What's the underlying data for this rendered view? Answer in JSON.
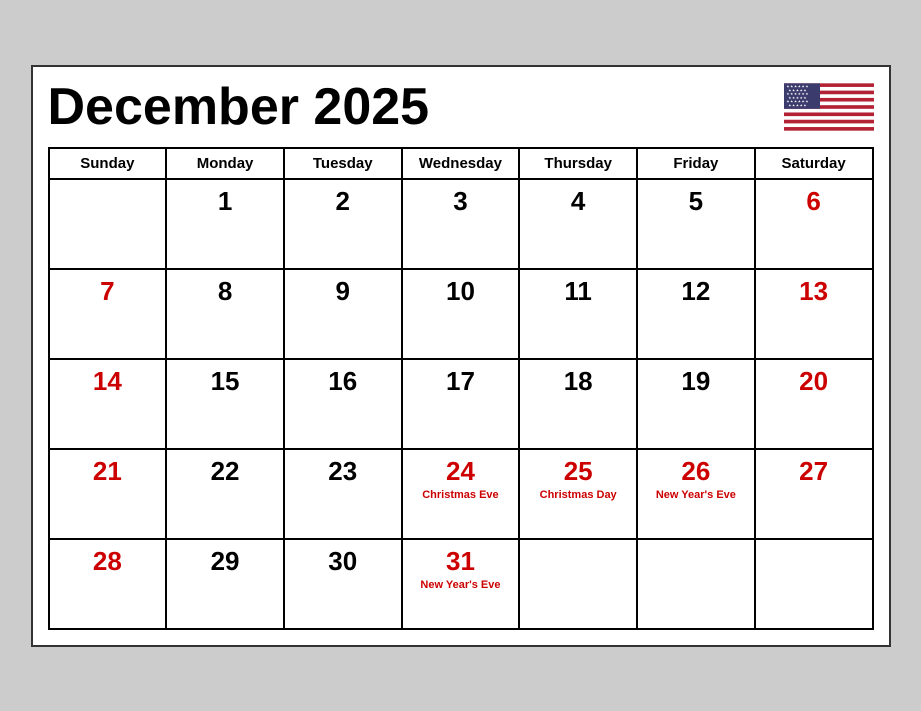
{
  "header": {
    "title": "December 2025"
  },
  "days_of_week": [
    "Sunday",
    "Monday",
    "Tuesday",
    "Wednesday",
    "Thursday",
    "Friday",
    "Saturday"
  ],
  "weeks": [
    [
      {
        "num": "",
        "color": "black",
        "holiday": ""
      },
      {
        "num": "1",
        "color": "black",
        "holiday": ""
      },
      {
        "num": "2",
        "color": "black",
        "holiday": ""
      },
      {
        "num": "3",
        "color": "black",
        "holiday": ""
      },
      {
        "num": "4",
        "color": "black",
        "holiday": ""
      },
      {
        "num": "5",
        "color": "black",
        "holiday": ""
      },
      {
        "num": "6",
        "color": "red",
        "holiday": ""
      }
    ],
    [
      {
        "num": "7",
        "color": "red",
        "holiday": ""
      },
      {
        "num": "8",
        "color": "black",
        "holiday": ""
      },
      {
        "num": "9",
        "color": "black",
        "holiday": ""
      },
      {
        "num": "10",
        "color": "black",
        "holiday": ""
      },
      {
        "num": "11",
        "color": "black",
        "holiday": ""
      },
      {
        "num": "12",
        "color": "black",
        "holiday": ""
      },
      {
        "num": "13",
        "color": "red",
        "holiday": ""
      }
    ],
    [
      {
        "num": "14",
        "color": "red",
        "holiday": ""
      },
      {
        "num": "15",
        "color": "black",
        "holiday": ""
      },
      {
        "num": "16",
        "color": "black",
        "holiday": ""
      },
      {
        "num": "17",
        "color": "black",
        "holiday": ""
      },
      {
        "num": "18",
        "color": "black",
        "holiday": ""
      },
      {
        "num": "19",
        "color": "black",
        "holiday": ""
      },
      {
        "num": "20",
        "color": "red",
        "holiday": ""
      }
    ],
    [
      {
        "num": "21",
        "color": "red",
        "holiday": ""
      },
      {
        "num": "22",
        "color": "black",
        "holiday": ""
      },
      {
        "num": "23",
        "color": "black",
        "holiday": ""
      },
      {
        "num": "24",
        "color": "red",
        "holiday": "Christmas Eve"
      },
      {
        "num": "25",
        "color": "red",
        "holiday": "Christmas Day"
      },
      {
        "num": "26",
        "color": "red",
        "holiday": "New Year's Eve"
      },
      {
        "num": "27",
        "color": "red",
        "holiday": ""
      }
    ],
    [
      {
        "num": "28",
        "color": "red",
        "holiday": ""
      },
      {
        "num": "29",
        "color": "black",
        "holiday": ""
      },
      {
        "num": "30",
        "color": "black",
        "holiday": ""
      },
      {
        "num": "31",
        "color": "red",
        "holiday": "New Year's Eve"
      },
      {
        "num": "",
        "color": "black",
        "holiday": ""
      },
      {
        "num": "",
        "color": "black",
        "holiday": ""
      },
      {
        "num": "",
        "color": "black",
        "holiday": ""
      }
    ]
  ]
}
